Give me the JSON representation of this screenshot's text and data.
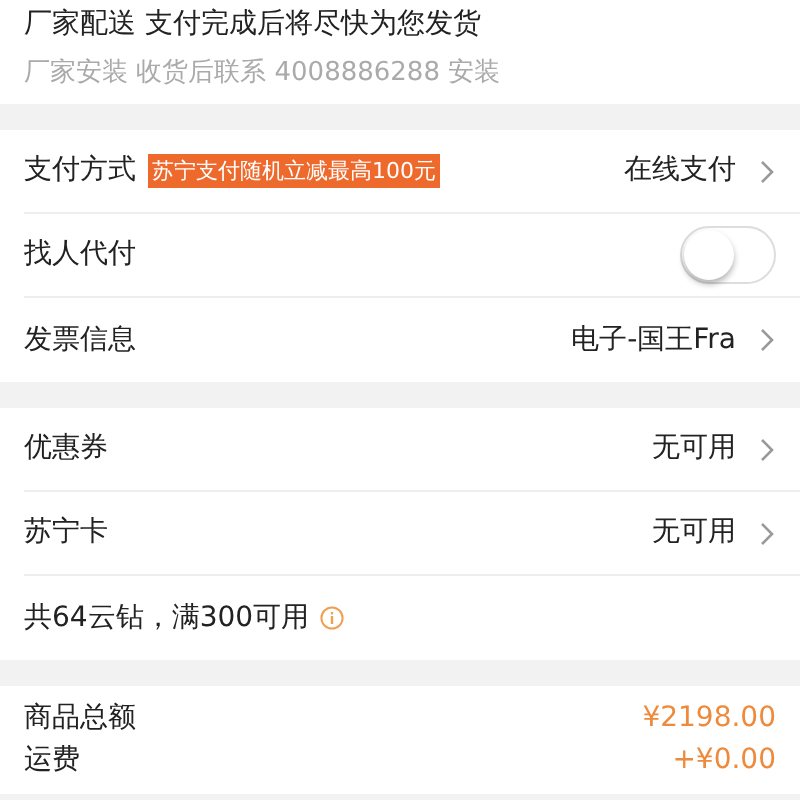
{
  "delivery": {
    "title": "厂家配送 支付完成后将尽快为您发货",
    "note": "厂家安装  收货后联系 4008886288 安装"
  },
  "sections": [
    {
      "rows": [
        {
          "kind": "link",
          "label": "支付方式",
          "tag": "苏宁支付随机立减最高100元",
          "value": "在线支付"
        },
        {
          "kind": "toggle",
          "label": "找人代付",
          "on": false
        },
        {
          "kind": "link",
          "label": "发票信息",
          "value": "电子-国王Fra"
        }
      ]
    },
    {
      "rows": [
        {
          "kind": "link",
          "label": "优惠券",
          "value": "无可用"
        },
        {
          "kind": "link",
          "label": "苏宁卡",
          "value": "无可用"
        },
        {
          "kind": "info",
          "label": "共64云钻，满300可用"
        }
      ]
    }
  ],
  "summary": [
    {
      "label": "商品总额",
      "amount": "¥2198.00"
    },
    {
      "label": "运费",
      "amount": "+¥0.00"
    }
  ]
}
